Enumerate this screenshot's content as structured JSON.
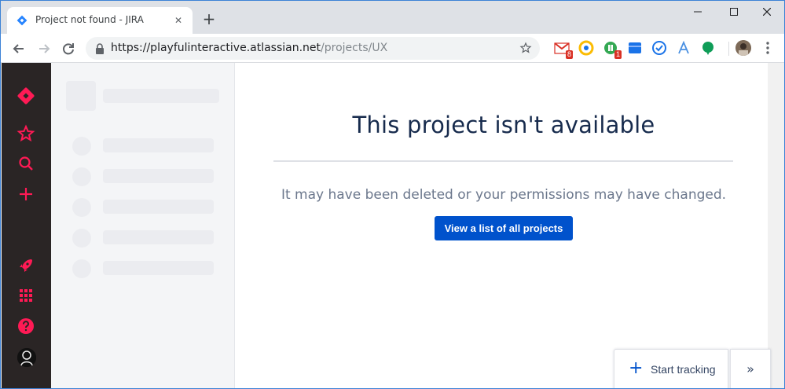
{
  "browser": {
    "tab": {
      "title": "Project not found - JIRA",
      "close_glyph": "✕",
      "favicon_icon": "jira-diamond-icon"
    },
    "new_tab_glyph": "+",
    "address": {
      "host": "https://playfulinteractive.atlassian.net",
      "path": "/projects/UX"
    },
    "extensions": [
      {
        "name": "gmail-icon",
        "badge": "8",
        "color": "#d93025"
      },
      {
        "name": "chrome-logo-icon",
        "color": "#fbbc04"
      },
      {
        "name": "ext-green-icon",
        "badge": "1",
        "color": "#34a853"
      },
      {
        "name": "ext-blue-square-icon",
        "color": "#1a73e8"
      },
      {
        "name": "ext-check-icon",
        "color": "#1a73e8"
      },
      {
        "name": "ext-a-icon",
        "color": "#4a90e2"
      },
      {
        "name": "ext-leaf-icon",
        "color": "#0f9d58"
      }
    ]
  },
  "colors": {
    "jira_red": "#ff1a55",
    "nav_bg": "#2a2525",
    "primary_blue": "#0052cc"
  },
  "global_nav": {
    "items": [
      "jira-logo-icon",
      "star-icon",
      "search-icon",
      "create-plus-icon",
      "rocket-icon",
      "apps-grid-icon",
      "help-icon",
      "profile-avatar"
    ]
  },
  "main": {
    "title": "This project isn't available",
    "message": "It may have been deleted or your permissions may have changed.",
    "button_label": "View a list of all projects"
  },
  "tracking": {
    "label": "Start tracking",
    "plus_glyph": "+",
    "expand_glyph": "»"
  }
}
